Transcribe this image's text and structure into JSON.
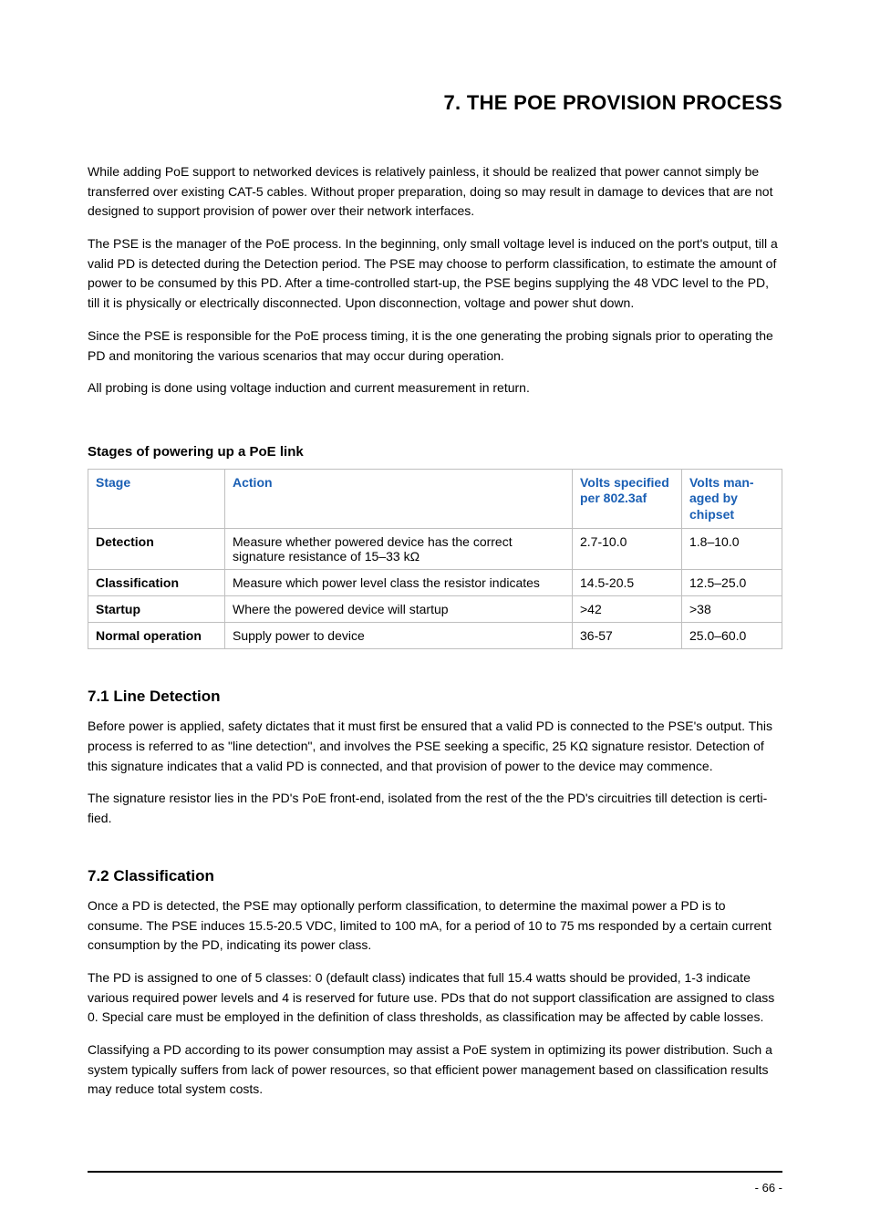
{
  "chapter_title": "7. THE POE PROVISION PROCESS",
  "paragraphs_intro": [
    "While adding PoE support to networked devices is relatively painless, it should be realized that power cannot simply be transferred over existing CAT-5 cables. Without proper preparation, doing so may result in damage to devices that are not designed to support provision of power over their network interfaces.",
    "The PSE is the manager of the PoE process. In the beginning, only small voltage level is induced on the port's output, till a valid PD is detected during the Detection period. The PSE may choose to perform classification, to estimate the amount of power to be consumed by this PD. After a time-controlled start-up, the PSE begins supplying the 48 VDC level to the PD, till it is physically or electrically disconnected. Upon disconnection, voltage and power shut down.",
    "Since the PSE is responsible for the PoE process timing, it is the one generating the probing signals prior to operating the PD and monitoring the various scenarios that may occur during operation.",
    "All probing is done using voltage induction and current measurement in return."
  ],
  "table": {
    "caption": "Stages of powering up a PoE link",
    "headers": {
      "stage": "Stage",
      "action": "Action",
      "v_spec": "Volts speci­fied per 802.3af",
      "v_chip": "Volts man­aged by chipset"
    },
    "rows": [
      {
        "stage": "Detection",
        "action": "Measure whether powered device has the correct signature resistance of 15–33 kΩ",
        "v_spec": "2.7-10.0",
        "v_chip": "1.8–10.0"
      },
      {
        "stage": "Classification",
        "action": "Measure which power level class the resistor indi­cates",
        "v_spec": "14.5-20.5",
        "v_chip": "12.5–25.0"
      },
      {
        "stage": "Startup",
        "action": "Where the powered device will startup",
        "v_spec": ">42",
        "v_chip": ">38"
      },
      {
        "stage": "Normal operation",
        "action": "Supply power to device",
        "v_spec": "36-57",
        "v_chip": "25.0–60.0"
      }
    ]
  },
  "section_7_1": {
    "heading": "7.1 Line Detection",
    "paras": [
      "Before power is applied, safety dictates that it must first be ensured that a valid PD is connected to the PSE's output. This process is referred to as \"line detection\", and involves the PSE seeking a specific, 25 KΩ signature resistor. Detection of this signature indicates that a valid PD is connected, and that provision of power to the device may commence.",
      "The signature resistor lies in the PD's PoE front-end, isolated from the rest of the the PD's circuitries till detection is certi­fied."
    ]
  },
  "section_7_2": {
    "heading": "7.2 Classification",
    "paras": [
      "Once a PD is detected, the PSE may optionally perform classification, to determine the maximal power a PD is to consume. The PSE induces 15.5-20.5 VDC, limited to 100 mA, for a period of 10 to 75 ms responded by a certain current con­sumption by the PD, indicating its power class.",
      "The PD is assigned to one of 5 classes: 0 (default class) indicates that full 15.4 watts should be provided, 1-3 indicate various required power levels and 4 is reserved for future use. PDs that do not support classification are assigned to class 0. Special care must be employed in the definition of class thresholds, as classification may be affected by cable losses.",
      "Classifying a PD according to its power consumption may assist a PoE system in optimizing its power distribution. Such a system typically suffers from lack of power resources, so that efficient power management based on classification results may reduce total system costs."
    ]
  },
  "page_number": "- 66 -"
}
